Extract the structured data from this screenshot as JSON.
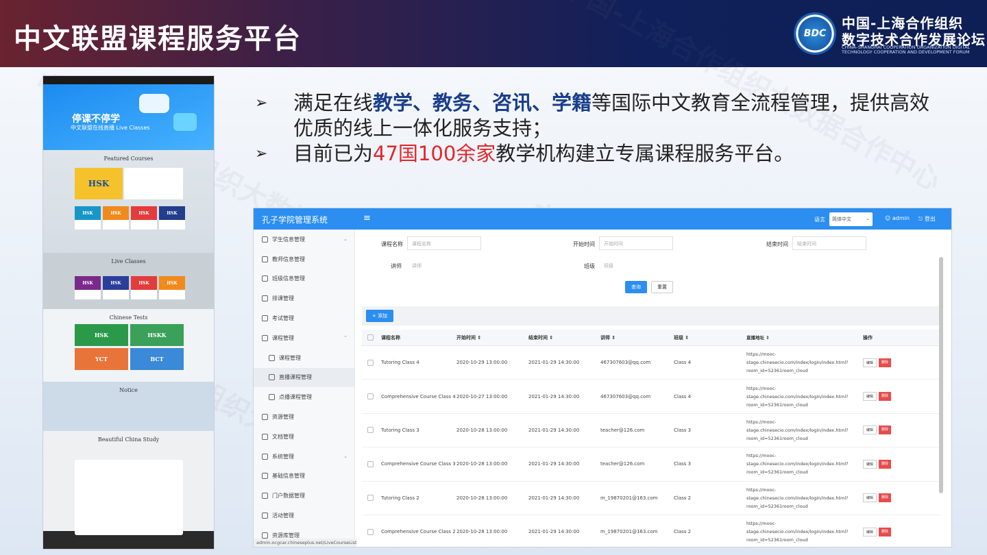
{
  "header": {
    "title": "中文联盟课程服务平台",
    "logo_mark": "BDC",
    "logo_cn_line1": "中国-上海合作组织",
    "logo_cn_line2": "数字技术合作发展论坛",
    "logo_en": "CHINA–SHANGHAI COOPERATION ORGANIZATION DIGITAL TECHNOLOGY COOPERATION AND DEVELOPMENT FORUM"
  },
  "bullets": {
    "arrow": "➢",
    "b1_pre": "满足在线",
    "b1_hl": "教学、教务、咨讯、学籍",
    "b1_post": "等国际中文教育全流程管理，提供高效优质的线上一体化服务支持；",
    "b2_pre": "目前已为",
    "b2_hl": "47国100余家",
    "b2_post": "教学机构建立专属课程服务平台。"
  },
  "preview": {
    "banner_title": "停课不停学",
    "banner_sub": "中文联盟在线直播 Live Classes",
    "featured": "Featured Courses",
    "live": "Live Classes",
    "tests": "Chinese Tests",
    "notice": "Notice",
    "china": "Beautiful China Study",
    "test_tiles": [
      "HSK",
      "HSKK",
      "YCT",
      "BCT"
    ],
    "thumb_labels": [
      "HSK",
      "HSK",
      "HSK",
      "HSK"
    ]
  },
  "admin": {
    "app_title": "孔子学院管理系统",
    "menu_icon": "≡",
    "lang_label": "语言",
    "lang_value": "简体中文",
    "user": "admin",
    "logout": "登出",
    "sidebar": [
      {
        "label": "学生信息管理",
        "chev": "⌄"
      },
      {
        "label": "教师信息管理",
        "chev": ""
      },
      {
        "label": "班级信息管理",
        "chev": ""
      },
      {
        "label": "排课管理",
        "chev": ""
      },
      {
        "label": "考试管理",
        "chev": ""
      },
      {
        "label": "课程管理",
        "chev": "⌃"
      },
      {
        "label": "课程管理",
        "chev": "",
        "sub": true
      },
      {
        "label": "直播课程管理",
        "chev": "",
        "sub": true,
        "active": true
      },
      {
        "label": "点播课程管理",
        "chev": "",
        "sub": true
      },
      {
        "label": "资源管理",
        "chev": ""
      },
      {
        "label": "文档管理",
        "chev": ""
      },
      {
        "label": "系统管理",
        "chev": "⌄"
      },
      {
        "label": "基础信息管理",
        "chev": ""
      },
      {
        "label": "门户数据管理",
        "chev": ""
      },
      {
        "label": "活动管理",
        "chev": ""
      },
      {
        "label": "资源库管理",
        "chev": ""
      }
    ],
    "filters": {
      "course_name_label": "课程名称",
      "course_name_ph": "课程名称",
      "start_label": "开始时间",
      "start_ph": "开始时间",
      "end_label": "结束时间",
      "end_ph": "结束时间",
      "teacher_label": "讲师",
      "teacher_ph": "讲师",
      "class_label": "班级",
      "class_ph": "班级",
      "search": "查询",
      "reset": "重置"
    },
    "add_button": "+ 添加",
    "table": {
      "headers": [
        "课程名称",
        "开始时间 ⇕",
        "结束时间 ⇕",
        "讲师 ⇕",
        "班级 ⇕",
        "直播地址 ⇕",
        "操作"
      ],
      "edit": "编辑",
      "delete": "删除",
      "rows": [
        [
          "Tutoring Class 4",
          "2020-10-29 13:00:00",
          "2021-01-29 14:30:00",
          "467307603@qq.com",
          "Class 4",
          "https://mooc-stage.chinesecio.com/index/login/index.html?room_id=52361room_cloud"
        ],
        [
          "Comprehensive Course Class 4",
          "2020-10-27 13:00:00",
          "2021-01-29 14:30:00",
          "467307603@qq.com",
          "Class 4",
          "https://mooc-stage.chinesecio.com/index/login/index.html?room_id=52361room_cloud"
        ],
        [
          "Tutoring Class 3",
          "2020-10-28 13:00:00",
          "2021-01-29 14:30:00",
          "teacher@126.com",
          "Class 3",
          "https://mooc-stage.chinesecio.com/index/login/index.html?room_id=52361room_cloud"
        ],
        [
          "Comprehensive Course Class 3",
          "2020-10-28 13:00:00",
          "2021-01-29 14:30:00",
          "teacher@126.com",
          "Class 3",
          "https://mooc-stage.chinesecio.com/index/login/index.html?room_id=52361room_cloud"
        ],
        [
          "Tutoring Class 2",
          "2020-10-28 13:00:00",
          "2021-01-29 14:30:00",
          "m_19870201@163.com",
          "Class 2",
          "https://mooc-stage.chinesecio.com/index/login/index.html?room_id=52361room_cloud"
        ],
        [
          "Comprehensive Course Class 2",
          "2020-10-28 13:00:00",
          "2021-01-29 14:30:00",
          "m_19870201@163.com",
          "Class 2",
          "https://mooc-stage.chinesecio.com/index/login/index.html?room_id=52361room_cloud"
        ]
      ]
    },
    "status_url": "admin.ocgcar.chineseplus.net/LiveCourseList"
  },
  "watermark": "中国-上海合作组织大数据合作中心",
  "colors": {
    "accent": "#2b8ef0",
    "highlight_blue": "#1a3e8c",
    "highlight_red": "#e3262a",
    "danger": "#e94b4b"
  }
}
